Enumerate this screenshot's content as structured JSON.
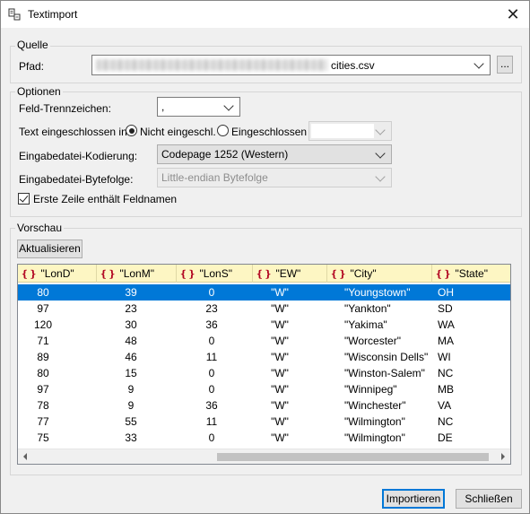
{
  "window": {
    "title": "Textimport",
    "close_glyph": "✕"
  },
  "source": {
    "legend": "Quelle",
    "path_label": "Pfad:",
    "path_suffix": "cities.csv",
    "browse_label": "..."
  },
  "options": {
    "legend": "Optionen",
    "delimiter_label": "Feld-Trennzeichen:",
    "delimiter_value": ",",
    "enclosed_label": "Text eingeschlossen in:",
    "radio_not_enclosed": "Nicht eingeschl.",
    "radio_enclosed": "Eingeschlossen",
    "encoding_label": "Eingabedatei-Kodierung:",
    "encoding_value": "Codepage 1252 (Western)",
    "byteorder_label": "Eingabedatei-Bytefolge:",
    "byteorder_value": "Little-endian Bytefolge",
    "first_row_label": "Erste Zeile enthält Feldnamen"
  },
  "preview": {
    "legend": "Vorschau",
    "refresh_label": "Aktualisieren",
    "icon_glyph": "❴❵",
    "columns": [
      "\"LonD\"",
      "\"LonM\"",
      "\"LonS\"",
      "\"EW\"",
      "\"City\"",
      "\"State\""
    ],
    "rows": [
      {
        "lond": "80",
        "lonm": "39",
        "lons": "0",
        "ew": "\"W\"",
        "city": "\"Youngstown\"",
        "state": "OH"
      },
      {
        "lond": "97",
        "lonm": "23",
        "lons": "23",
        "ew": "\"W\"",
        "city": "\"Yankton\"",
        "state": "SD"
      },
      {
        "lond": "120",
        "lonm": "30",
        "lons": "36",
        "ew": "\"W\"",
        "city": "\"Yakima\"",
        "state": "WA"
      },
      {
        "lond": "71",
        "lonm": "48",
        "lons": "0",
        "ew": "\"W\"",
        "city": "\"Worcester\"",
        "state": "MA"
      },
      {
        "lond": "89",
        "lonm": "46",
        "lons": "11",
        "ew": "\"W\"",
        "city": "\"Wisconsin Dells\"",
        "state": "WI"
      },
      {
        "lond": "80",
        "lonm": "15",
        "lons": "0",
        "ew": "\"W\"",
        "city": "\"Winston-Salem\"",
        "state": "NC"
      },
      {
        "lond": "97",
        "lonm": "9",
        "lons": "0",
        "ew": "\"W\"",
        "city": "\"Winnipeg\"",
        "state": "MB"
      },
      {
        "lond": "78",
        "lonm": "9",
        "lons": "36",
        "ew": "\"W\"",
        "city": "\"Winchester\"",
        "state": "VA"
      },
      {
        "lond": "77",
        "lonm": "55",
        "lons": "11",
        "ew": "\"W\"",
        "city": "\"Wilmington\"",
        "state": "NC"
      },
      {
        "lond": "75",
        "lonm": "33",
        "lons": "0",
        "ew": "\"W\"",
        "city": "\"Wilmington\"",
        "state": "DE"
      }
    ]
  },
  "footer": {
    "import_label": "Importieren",
    "close_label": "Schließen"
  }
}
